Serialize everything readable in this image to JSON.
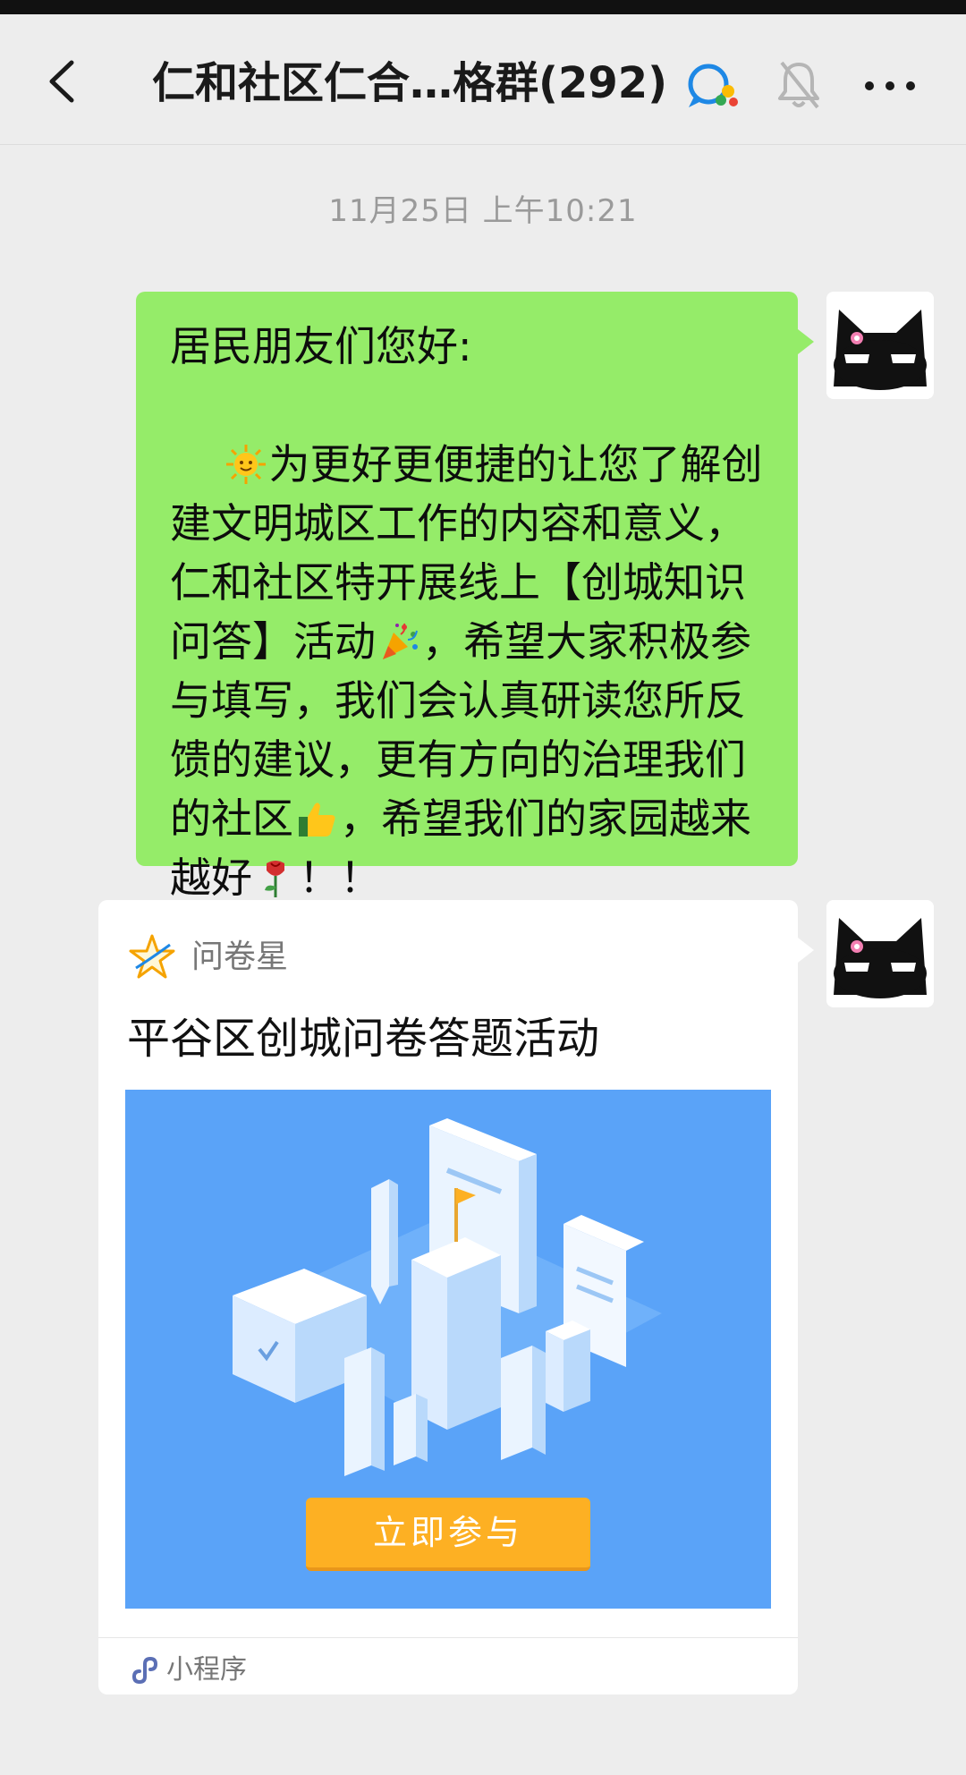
{
  "header": {
    "title": "仁和社区仁合…格群(292)",
    "back_icon": "chevron-left-icon",
    "chat_icon": "group-chat-icon",
    "mute_icon": "bell-muted-icon",
    "more_icon": "more-dots-icon"
  },
  "timestamp": "11月25日 上午10:21",
  "message": {
    "greeting": "居民朋友们您好:",
    "seg1": "为更好更便捷的让您了解创建文明城区工作的内容和意义，仁和社区特开展线上【创城知识问答】活动",
    "seg2": "，希望大家积极参与填写，我们会认真研读您所反馈的建议，更有方向的治理我们的社区",
    "seg3": "，希望我们的家园越来越好",
    "seg4": "！！",
    "emojis": [
      "sun-emoji",
      "party-popper-emoji",
      "thumbs-up-emoji",
      "rose-emoji"
    ],
    "bubble_color": "#95ec69"
  },
  "card": {
    "source": "问卷星",
    "title": "平谷区创城问卷答题活动",
    "button": "立即参与",
    "footer": "小程序",
    "image_bg": "#5aa3f8",
    "button_color": "#fdb023"
  },
  "avatar_icon": "black-cat-avatar"
}
